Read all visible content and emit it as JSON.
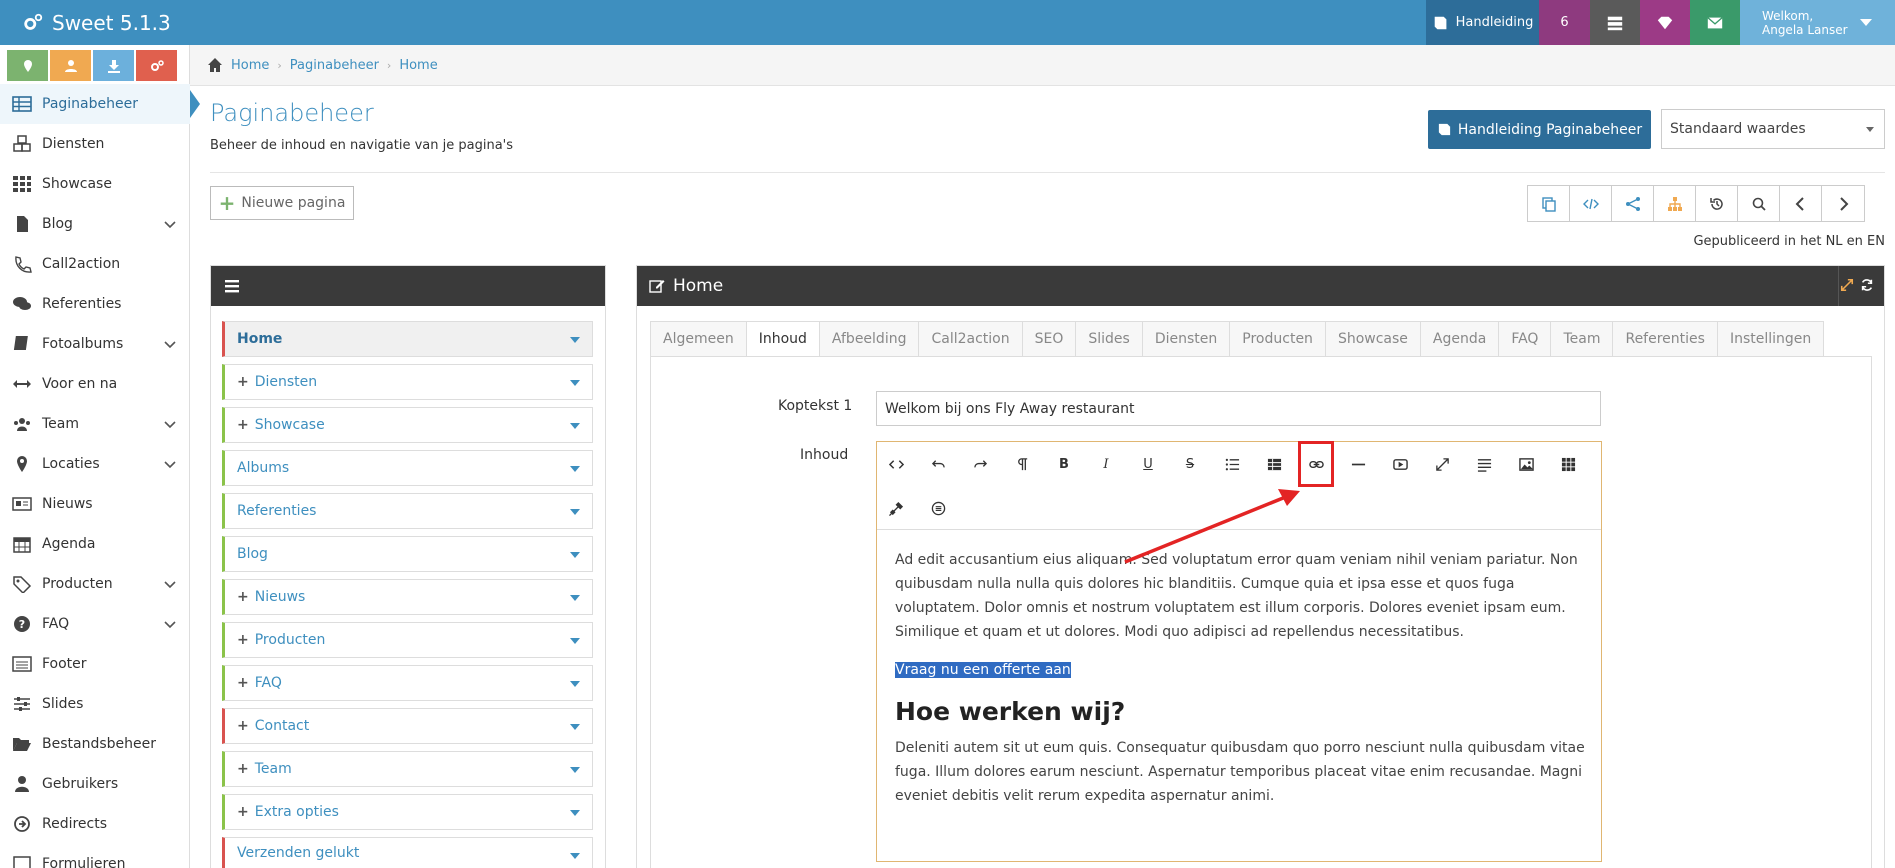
{
  "app": {
    "title": "Sweet 5.1.3"
  },
  "topbar": {
    "manual_label": "Handleiding",
    "count": "6",
    "welcome": "Welkom,",
    "user": "Angela Lanser"
  },
  "sidebar": {
    "items": [
      {
        "label": "Paginabeheer"
      },
      {
        "label": "Diensten"
      },
      {
        "label": "Showcase"
      },
      {
        "label": "Blog"
      },
      {
        "label": "Call2action"
      },
      {
        "label": "Referenties"
      },
      {
        "label": "Fotoalbums"
      },
      {
        "label": "Voor en na"
      },
      {
        "label": "Team"
      },
      {
        "label": "Locaties"
      },
      {
        "label": "Nieuws"
      },
      {
        "label": "Agenda"
      },
      {
        "label": "Producten"
      },
      {
        "label": "FAQ"
      },
      {
        "label": "Footer"
      },
      {
        "label": "Slides"
      },
      {
        "label": "Bestandsbeheer"
      },
      {
        "label": "Gebruikers"
      },
      {
        "label": "Redirects"
      },
      {
        "label": "Formulieren"
      }
    ]
  },
  "breadcrumb": [
    "Home",
    "Paginabeheer",
    "Home"
  ],
  "page": {
    "title": "Paginabeheer",
    "subtitle": "Beheer de inhoud en navigatie van je pagina's",
    "manual_button": "Handleiding Paginabeheer",
    "select_value": "Standaard waardes",
    "new_page": "Nieuwe pagina",
    "published": "Gepubliceerd in het NL en EN"
  },
  "tree": {
    "items": [
      {
        "label": "Home"
      },
      {
        "label": "Diensten"
      },
      {
        "label": "Showcase"
      },
      {
        "label": "Albums"
      },
      {
        "label": "Referenties"
      },
      {
        "label": "Blog"
      },
      {
        "label": "Nieuws"
      },
      {
        "label": "Producten"
      },
      {
        "label": "FAQ"
      },
      {
        "label": "Contact"
      },
      {
        "label": "Team"
      },
      {
        "label": "Extra opties"
      },
      {
        "label": "Verzenden gelukt"
      }
    ]
  },
  "editor": {
    "panel_title": "Home",
    "tabs": [
      "Algemeen",
      "Inhoud",
      "Afbeelding",
      "Call2action",
      "SEO",
      "Slides",
      "Diensten",
      "Producten",
      "Showcase",
      "Agenda",
      "FAQ",
      "Team",
      "Referenties",
      "Instellingen"
    ],
    "heading_label": "Koptekst 1",
    "heading_value": "Welkom bij ons Fly Away restaurant",
    "content_label": "Inhoud",
    "paragraph1": "Ad edit accusantium eius aliquam. Sed voluptatum error quam veniam nihil veniam pariatur. Non quibusdam nulla nulla quis dolores hic blanditiis. Cumque quia et ipsa esse et quos fuga voluptatem. Dolor omnis et nostrum voluptatem est illum corporis. Dolores eveniet ipsam eum. Similique et quam et ut dolores. Modi quo adipisci ad repellendus necessitatibus.",
    "selected_text": "Vraag nu een offerte aan",
    "heading2": "Hoe werken wij?",
    "paragraph2": "Deleniti autem sit ut eum quis. Consequatur quibusdam quo porro nesciunt nulla quibusdam vitae fuga. Illum dolores earum nesciunt. Aspernatur temporibus placeat vitae enim recusandae. Magni eveniet debitis velit rerum expedita aspernatur animi."
  },
  "colors": {
    "topbar": "#3e8fbf",
    "accent": "#2d6d99",
    "highlight_box": "#e32424"
  }
}
